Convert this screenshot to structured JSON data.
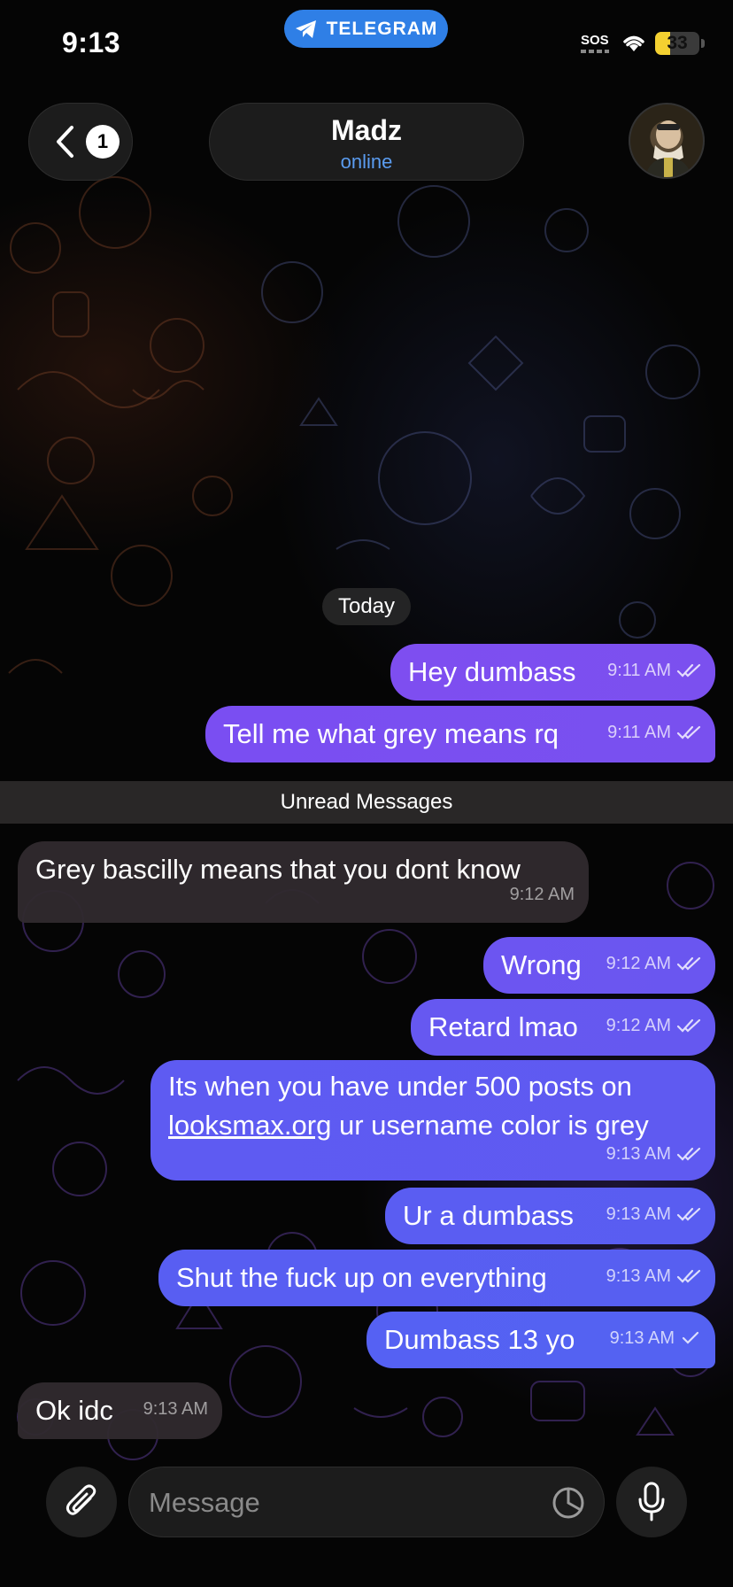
{
  "status_bar": {
    "time": "9:13",
    "app_pill": "TELEGRAM",
    "sos": "SOS",
    "battery_level": "33",
    "battery_fraction": 0.33
  },
  "header": {
    "back_badge": "1",
    "chat_name": "Madz",
    "chat_status": "online"
  },
  "date_chip": "Today",
  "unread_divider": "Unread Messages",
  "messages": [
    {
      "text": "Hey dumbass",
      "time": "9:11 AM",
      "direction": "out",
      "status": "read"
    },
    {
      "text": "Tell me what grey means rq",
      "time": "9:11 AM",
      "direction": "out",
      "status": "read"
    },
    {
      "text": "Grey bascilly means that you dont know",
      "time": "9:12 AM",
      "direction": "in"
    },
    {
      "text": "Wrong",
      "time": "9:12 AM",
      "direction": "out",
      "status": "read"
    },
    {
      "text": "Retard lmao",
      "time": "9:12 AM",
      "direction": "out",
      "status": "read"
    },
    {
      "text_before_link": "Its when you have under 500 posts on ",
      "link": "looksmax.org",
      "text_after_link": " ur username color is grey",
      "time": "9:13 AM",
      "direction": "out",
      "status": "read"
    },
    {
      "text": "Ur a dumbass",
      "time": "9:13 AM",
      "direction": "out",
      "status": "read"
    },
    {
      "text": "Shut the fuck up on everything",
      "time": "9:13 AM",
      "direction": "out",
      "status": "read"
    },
    {
      "text": "Dumbass 13 yo",
      "time": "9:13 AM",
      "direction": "out",
      "status": "sent"
    },
    {
      "text": "Ok idc",
      "time": "9:13 AM",
      "direction": "in"
    }
  ],
  "composer": {
    "placeholder": "Message"
  },
  "icons": [
    "telegram-plane-icon",
    "wifi-icon",
    "chevron-left-icon",
    "read-checks-icon",
    "sent-check-icon",
    "paperclip-icon",
    "sticker-icon",
    "microphone-icon"
  ],
  "colors": {
    "pill_blue": "#2f7fe6",
    "status_online": "#5a9cf0",
    "bubble_purple": "#7b4ff0",
    "bubble_blue": "#5159f0",
    "battery_yellow": "#f4d131"
  }
}
